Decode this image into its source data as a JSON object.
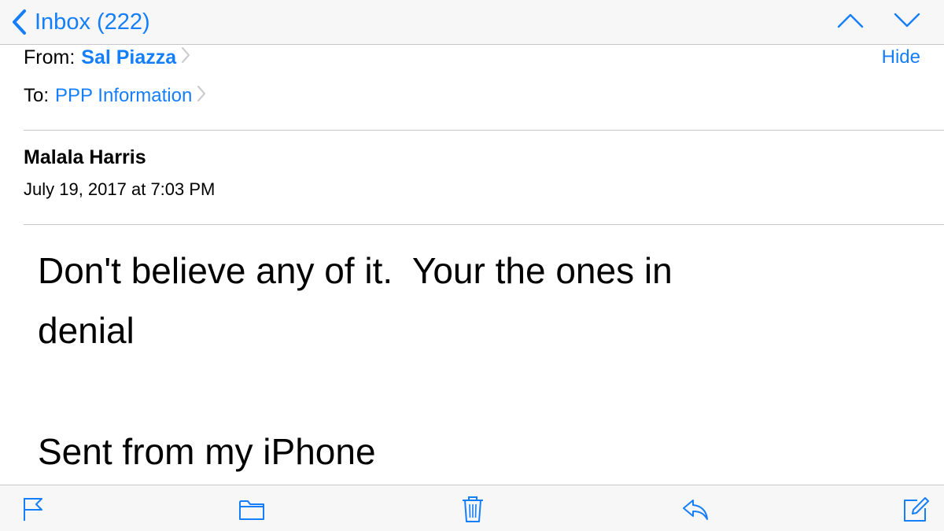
{
  "navbar": {
    "back_label": "Inbox (222)",
    "icons": [
      "chevron-left-icon",
      "chevron-up-icon",
      "chevron-down-icon"
    ]
  },
  "header": {
    "from_label": "From:",
    "from_value": "Sal Piazza",
    "to_label": "To:",
    "to_value": "PPP Information",
    "hide_label": "Hide"
  },
  "message": {
    "subject": "Malala Harris",
    "date": "July 19, 2017 at 7:03 PM",
    "body": "Don't believe any of it.  Your the ones in\ndenial",
    "signature": "Sent from my iPhone"
  },
  "toolbar": {
    "icons": [
      "flag-icon",
      "folder-icon",
      "trash-icon",
      "reply-icon",
      "compose-icon"
    ]
  },
  "colors": {
    "accent": "#157efb",
    "bar_background": "#f7f7f8",
    "separator": "#c8c7cc"
  }
}
